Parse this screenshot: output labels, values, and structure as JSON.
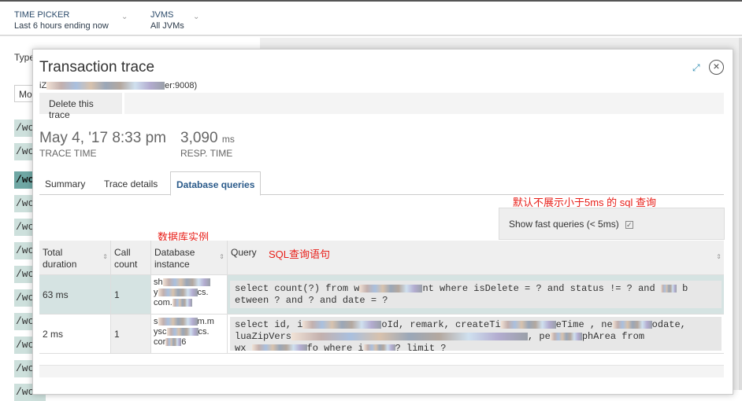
{
  "topbar": {
    "time_picker_label": "TIME PICKER",
    "time_picker_value": "Last 6 hours ending now",
    "jvms_label": "JVMS",
    "jvms_value": "All JVMs"
  },
  "background": {
    "type_label": "Type",
    "select_value": "Mo",
    "rows": [
      "/wo",
      "/wo",
      "/wo",
      "/wo",
      "/wo",
      "/wo",
      "/wo",
      "/wo",
      "/wo",
      "/wo",
      "/wo",
      "/wo"
    ],
    "active_row": 2
  },
  "modal": {
    "title": "Transaction trace",
    "subtitle_prefix": "iZ",
    "subtitle_suffix": "er:9008)",
    "delete_label": "Delete this trace",
    "trace_time": "May 4, '17 8:33 pm",
    "trace_time_label": "TRACE TIME",
    "resp_time": "3,090",
    "resp_unit": "ms",
    "resp_time_label": "RESP. TIME",
    "tabs": [
      "Summary",
      "Trace details",
      "Database queries"
    ],
    "active_tab": 2,
    "fast_queries_label": "Show fast queries (< 5ms)",
    "fast_queries_checked": true,
    "columns": [
      "Total duration",
      "Call count",
      "Database instance",
      "Query"
    ],
    "rows": [
      {
        "duration": "63 ms",
        "count": "1",
        "instance": [
          "sh",
          "y",
          "cs.",
          "com."
        ],
        "query": "select count(?) from w",
        "query_a": "nt where isDelete = ? and status != ? and ",
        "query_b": " b",
        "query_c": "etween ? and ? and date = ?"
      },
      {
        "duration": "2 ms",
        "count": "1",
        "instance": [
          "s",
          "m.m",
          "ysc",
          "cs.",
          "cor",
          "6"
        ],
        "query": "select id, i",
        "query_a": "oId, remark, createTi",
        "query_b": "eTime , ne",
        "query_c": "odate,",
        "query_d": "luaZipVers",
        "query_e": ", pe",
        "query_f": "phArea from",
        "query_g": "wx_",
        "query_h": "fo where i",
        "query_i": "? limit ?"
      }
    ]
  },
  "annotations": {
    "fast_note": "默认不展示小于5ms 的 sql 查询",
    "instance_note": "数据库实例",
    "query_note": "SQL查询语句"
  },
  "colors": {
    "accent": "#2a5a8a",
    "annotation": "#e8201a",
    "row_highlight": "#d5e3e2",
    "active_row": "#6fa7a4"
  }
}
